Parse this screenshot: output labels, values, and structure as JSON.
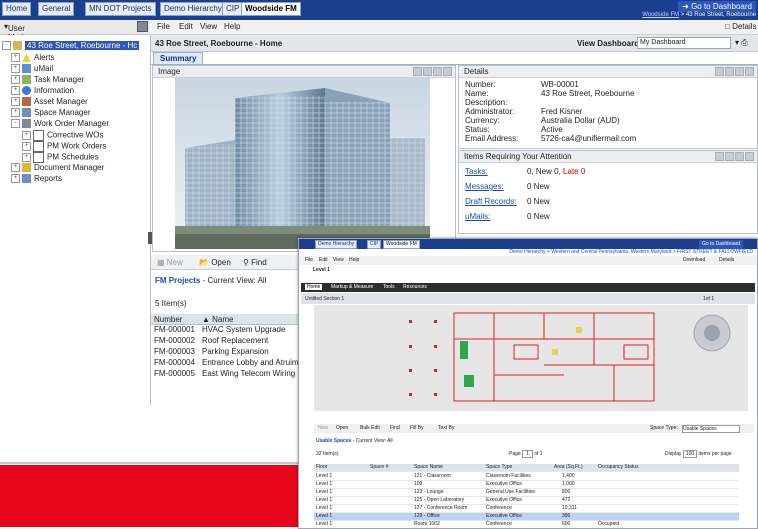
{
  "top_tabs": [
    {
      "label": "Home",
      "active": false
    },
    {
      "label": "General",
      "active": false
    },
    {
      "label": "MN DOT Projects",
      "active": false
    },
    {
      "label": "Demo Hierarchy",
      "active": false
    },
    {
      "label": "CIP",
      "active": false
    },
    {
      "label": "Woodside FM",
      "active": true
    }
  ],
  "goto_dashboard": "Go to Dashboard",
  "breadcrumb": {
    "link": "Woodside FM",
    "rest": " > 43 Roe Street, Roebourne"
  },
  "user_mode": "User Mode",
  "menu": {
    "file": "File",
    "edit": "Edit",
    "view": "View",
    "help": "Help",
    "details": "Details"
  },
  "tree": {
    "root": "43 Roe Street, Roebourne - Hc",
    "items": [
      {
        "label": "Alerts",
        "icon": "alert-icon"
      },
      {
        "label": "uMail",
        "icon": "mail-icon"
      },
      {
        "label": "Task Manager",
        "icon": "task-icon"
      },
      {
        "label": "Information",
        "icon": "info-icon"
      },
      {
        "label": "Asset Manager",
        "icon": "asset-icon"
      },
      {
        "label": "Space Manager",
        "icon": "space-icon"
      },
      {
        "label": "Work Order Manager",
        "icon": "work-order-icon"
      }
    ],
    "sub_items": [
      "Corrective WOs",
      "PM Work Orders",
      "PM Schedules"
    ],
    "items2": [
      {
        "label": "Document Manager",
        "icon": "folder-icon"
      },
      {
        "label": "Reports",
        "icon": "reports-icon"
      }
    ]
  },
  "page_title": "43 Roe Street, Roebourne - Home",
  "view_dashboard_label": "View Dashboard",
  "view_dashboard_value": "My Dashboard",
  "summary_tab": "Summary",
  "image_portlet_title": "Image",
  "details": {
    "title": "Details",
    "rows": [
      {
        "k": "Number:",
        "v": "WB-00001"
      },
      {
        "k": "Name:",
        "v": "43 Roe Street, Roebourne"
      },
      {
        "k": "Description:",
        "v": ""
      },
      {
        "k": "Administrator:",
        "v": "Fred Kisner"
      },
      {
        "k": "Currency:",
        "v": "Australia Dollar (AUD)"
      },
      {
        "k": "Status:",
        "v": "Active"
      },
      {
        "k": "Email Address:",
        "v": "5726-ca4@unifiermail.com"
      }
    ]
  },
  "attention": {
    "title": "Items Requiring Your Attention",
    "tasks_label": "Tasks:",
    "tasks_new_prefix": "0, New",
    "tasks_new": "0,",
    "tasks_late_label": "Late",
    "tasks_late": "0",
    "messages_label": "Messages:",
    "messages_value": "0 New",
    "drafts_label": "Draft Records:",
    "drafts_value": "0 New",
    "umails_label": "uMails:",
    "umails_value": "0 New"
  },
  "fm_toolbar": {
    "new": "New",
    "open": "Open",
    "find": "Find"
  },
  "fm_projects": {
    "title": "FM Projects",
    "view": "- Current View: All",
    "count": "5 Item(s)",
    "col_number": "Number",
    "col_name": "Name",
    "rows": [
      {
        "number": "FM-000001",
        "name": "HVAC System Upgrade"
      },
      {
        "number": "FM-000002",
        "name": "Roof Replacement"
      },
      {
        "number": "FM-000003",
        "name": "Parking Expansion"
      },
      {
        "number": "FM-000004",
        "name": "Entrance Lobby and Atruim Renova"
      },
      {
        "number": "FM-000005",
        "name": "East Wing Telecom Wiring Upgrade"
      }
    ]
  },
  "overlay": {
    "tabs": [
      "Demo Hierarchy",
      "CIP",
      "Woodside FM"
    ],
    "goto": "Go to Dashboard",
    "crumb": "Demo Hierarchy > Western and Central Pennsylvania, Western Maryland > FIRST STREET & FALLOWFIELD",
    "menu": [
      "File",
      "Edit",
      "View",
      "Help"
    ],
    "download": "Download",
    "details": "Details",
    "level": "Level 1",
    "viewer_tabs": [
      "Home",
      "Markup & Measure",
      "Tools",
      "Resources"
    ],
    "section": "Untitled Section 1",
    "page_of": "1of 1",
    "toolbar": [
      "New",
      "Open",
      "Bulk Edit",
      "Find",
      "Fill By",
      "Text By"
    ],
    "space_type_label": "Space Type:",
    "space_type_value": "Usable Spaces",
    "list_title": "Usable Spaces",
    "list_view": "- Current View: All",
    "items": "32 Item(s)",
    "page_label": "Page",
    "page_value": "1",
    "of_label": "of 1",
    "display_label": "Display",
    "display_value": "100",
    "per_page": "items per page",
    "columns": [
      "Floor",
      "Space #",
      "Space Name",
      "Space Type",
      "Area (Sq.Ft.)",
      "Occupancy Status"
    ],
    "rows": [
      {
        "floor": "Level 1",
        "space": "",
        "name": "121 - Classroom",
        "type": "Classroom Facilities",
        "area": "1,400",
        "occ": ""
      },
      {
        "floor": "Level 1",
        "space": "",
        "name": "109",
        "type": "Executive Office",
        "area": "1,000",
        "occ": ""
      },
      {
        "floor": "Level 1",
        "space": "",
        "name": "123 - Lounge",
        "type": "General Use Facilities",
        "area": "800",
        "occ": ""
      },
      {
        "floor": "Level 1",
        "space": "",
        "name": "125 - Open Laboratory",
        "type": "Executive Office",
        "area": "472",
        "occ": ""
      },
      {
        "floor": "Level 1",
        "space": "",
        "name": "127 - Conference Room",
        "type": "Conference",
        "area": "10,311",
        "occ": ""
      },
      {
        "floor": "Level 1",
        "space": "",
        "name": "129 - Office",
        "type": "Executive Office",
        "area": "395",
        "occ": ""
      },
      {
        "floor": "Level 1",
        "space": "",
        "name": "Room 1002",
        "type": "Conference",
        "area": "600",
        "occ": "Occupied"
      }
    ]
  },
  "colors": {
    "brand_blue": "#1b3f8f",
    "banner_red": "#e8061b",
    "link": "#1a4bb0"
  }
}
